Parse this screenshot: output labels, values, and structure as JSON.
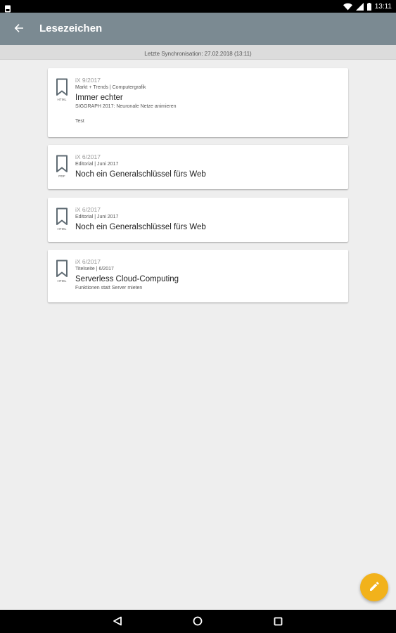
{
  "status_bar": {
    "time": "13:11",
    "icons": [
      "sim-card-icon",
      "wifi-icon",
      "signal-icon",
      "battery-icon"
    ]
  },
  "app_bar": {
    "title": "Lesezeichen",
    "background": "#7b8a92",
    "back_icon": "arrow-back-icon"
  },
  "sync": {
    "text": "Letzte Synchronisation: 27.02.2018 (13:11)"
  },
  "bookmarks": [
    {
      "type": "HTML",
      "issue": "iX 9/2017",
      "rubric": "Markt + Trends | Computergrafik",
      "title": "Immer echter",
      "subtitle": "SIGGRAPH 2017: Neuronale Netze animieren",
      "note": "Test"
    },
    {
      "type": "PDF",
      "issue": "iX 6/2017",
      "rubric": "Editorial | Juni 2017",
      "title": "Noch ein Generalschlüssel fürs Web",
      "subtitle": "",
      "note": ""
    },
    {
      "type": "HTML",
      "issue": "iX 6/2017",
      "rubric": "Editorial | Juni 2017",
      "title": "Noch ein Generalschlüssel fürs Web",
      "subtitle": "",
      "note": ""
    },
    {
      "type": "HTML",
      "issue": "iX 6/2017",
      "rubric": "Titelseite | 6/2017",
      "title": "Serverless Cloud-Computing",
      "subtitle": "Funktionen statt Server mieten",
      "note": ""
    }
  ],
  "fab": {
    "icon": "pencil-icon",
    "color": "#f2b21b"
  },
  "nav_bar": {
    "icons": [
      "back-triangle-icon",
      "home-circle-icon",
      "recents-square-icon"
    ]
  }
}
